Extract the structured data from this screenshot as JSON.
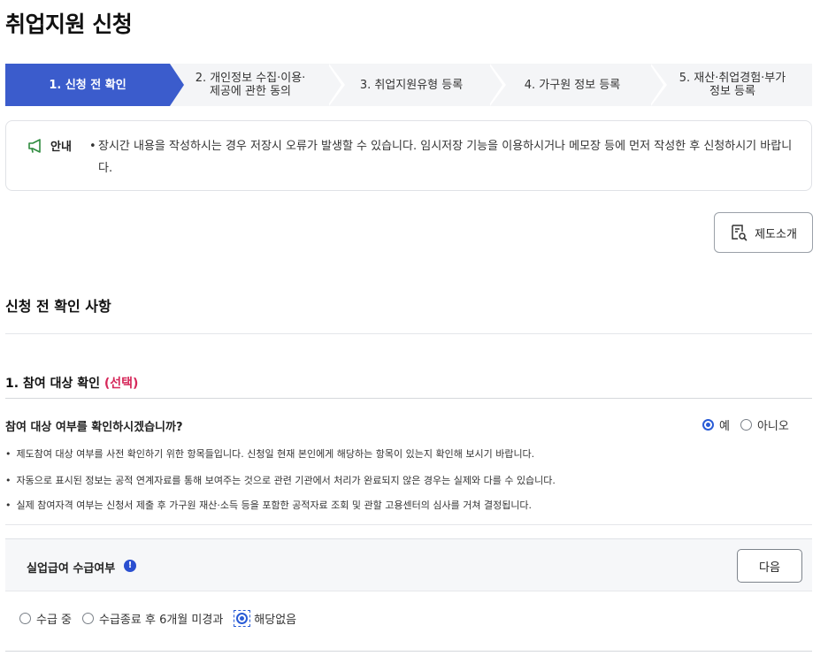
{
  "page": {
    "title": "취업지원 신청"
  },
  "stepper": {
    "steps": [
      {
        "label": "1. 신청 전 확인",
        "active": true
      },
      {
        "label_line1": "2. 개인정보 수집·이용·",
        "label_line2": "제공에 관한 동의"
      },
      {
        "label": "3. 취업지원유형 등록"
      },
      {
        "label": "4. 가구원 정보 등록"
      },
      {
        "label_line1": "5. 재산·취업경험·부가",
        "label_line2": "정보 등록"
      }
    ]
  },
  "notice": {
    "icon": "megaphone-icon",
    "label": "안내",
    "bullet": "•",
    "text": "장시간 내용을 작성하시는 경우 저장시 오류가 발생할 수 있습니다. 임시저장 기능을 이용하시거나 메모장 등에 먼저 작성한 후 신청하시기 바랍니다."
  },
  "intro_button": {
    "label": "제도소개",
    "icon": "document-search-icon"
  },
  "section": {
    "title": "신청 전 확인 사항"
  },
  "participation": {
    "title": "1. 참여 대상 확인",
    "optional": "(선택)",
    "question": "참여 대상 여부를 확인하시겠습니까?",
    "options": [
      {
        "label": "예",
        "selected": true
      },
      {
        "label": "아니오",
        "selected": false
      }
    ],
    "notes": [
      "제도참여 대상 여부를 사전 확인하기 위한 항목들입니다. 신청일 현재 본인에게 해당하는 항목이 있는지 확인해 보시기 바랍니다.",
      "자동으로 표시된 정보는 공적 연계자료를 통해 보여주는 것으로 관련 기관에서 처리가 완료되지 않은 경우는 실제와 다를 수 있습니다.",
      "실제 참여자격 여부는 신청서 제출 후 가구원 재산·소득 등을 포함한 공적자료 조회 및 관할 고용센터의 심사를 거쳐 결정됩니다."
    ],
    "note_bullet": "•"
  },
  "benefit": {
    "title": "실업급여 수급여부",
    "info_glyph": "!",
    "next_label": "다음",
    "options": [
      {
        "label": "수급 중",
        "selected": false
      },
      {
        "label": "수급종료 후 6개월 미경과",
        "selected": false
      },
      {
        "label": "해당없음",
        "selected": true
      }
    ]
  },
  "colors": {
    "accent": "#3b5ccc",
    "radio": "#2a5cd6",
    "optional": "#d6285a"
  }
}
